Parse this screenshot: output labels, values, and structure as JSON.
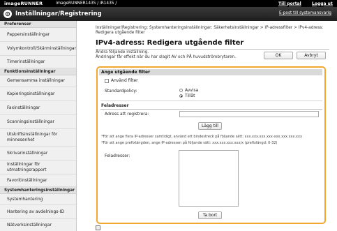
{
  "topbar": {
    "logo": "imageRUNNER",
    "device": "imageRUNNER1435 / iR1435 /",
    "portal": "Till portal",
    "logout": "Logga ut"
  },
  "titlebar": {
    "title": "Inställningar/Registrering",
    "email": "E-post till systemansvarig"
  },
  "sidebar": [
    {
      "type": "head",
      "label": "Preferenser"
    },
    {
      "type": "item",
      "label": "Pappersinställningar",
      "h": 20
    },
    {
      "type": "item",
      "label": "Volymkontroll/Skärminställningar",
      "h": 20
    },
    {
      "type": "item",
      "label": "Timerinställningar",
      "h": 18
    },
    {
      "type": "head",
      "label": "Funktionsinställningar"
    },
    {
      "type": "item",
      "label": "Gemensamma inställningar",
      "h": 17
    },
    {
      "type": "item",
      "label": "Kopieringsinställningar",
      "h": 20
    },
    {
      "type": "item",
      "label": "Faxinställningar",
      "h": 20
    },
    {
      "type": "item",
      "label": "Scanningsinställningar",
      "h": 20
    },
    {
      "type": "item",
      "label": "Utskriftsinställningar för minnesenhet",
      "h": 25
    },
    {
      "type": "item",
      "label": "Skrivarinställningar",
      "h": 20
    },
    {
      "type": "item",
      "label": "Inställningar för utmatningsrapport",
      "h": 20
    },
    {
      "type": "item",
      "label": "Favoritinställningar",
      "h": 18
    },
    {
      "type": "head",
      "label": "Systemhanteringsinställningar"
    },
    {
      "type": "item",
      "label": "Systemhantering",
      "h": 16
    },
    {
      "type": "item",
      "label": "Hantering av avdelnings-ID",
      "h": 20
    },
    {
      "type": "item",
      "label": "Nätverksinställningar",
      "h": 18
    }
  ],
  "main": {
    "breadcrumb": "Inställningar/Registrering: Systemhanteringsinställningar: Säkerhetsinställningar > IP-adressfilter > IPv4-adress: Redigera utgående filter",
    "title": "IPv4-adress: Redigera utgående filter",
    "notice_line1": "Ändra följande inställning.",
    "notice_line2": "Ändringar får effekt när du har slagit AV och PÅ huvudströmbrytaren.",
    "ok_label": "OK",
    "cancel_label": "Avbryt"
  },
  "filter_section": {
    "heading": "Ange utgående filter",
    "use_filter_label": "Använd filter",
    "use_filter_checked": false,
    "policy_label": "Standardpolicy:",
    "policy_options": [
      "Avvisa",
      "Tillåt"
    ],
    "policy_selected": "Tillåt"
  },
  "exceptions_section": {
    "heading": "Feladresser",
    "address_label": "Adress att registrera:",
    "address_value": "",
    "add_button": "Lägg till",
    "note1": "*För att ange flera IP-adresser samtidigt, använd ett bindestreck på följande sätt: xxx.xxx.xxx.xxx-xxx.xxx.xxx.xxx",
    "note2": "*För att ange prefixlängden, ange IP-adressen på följande sätt: xxx.xxx.xxx.xxx/x (prefixlängd: 0-32)",
    "list_label": "Feladresser:",
    "delete_button": "Ta bort"
  }
}
